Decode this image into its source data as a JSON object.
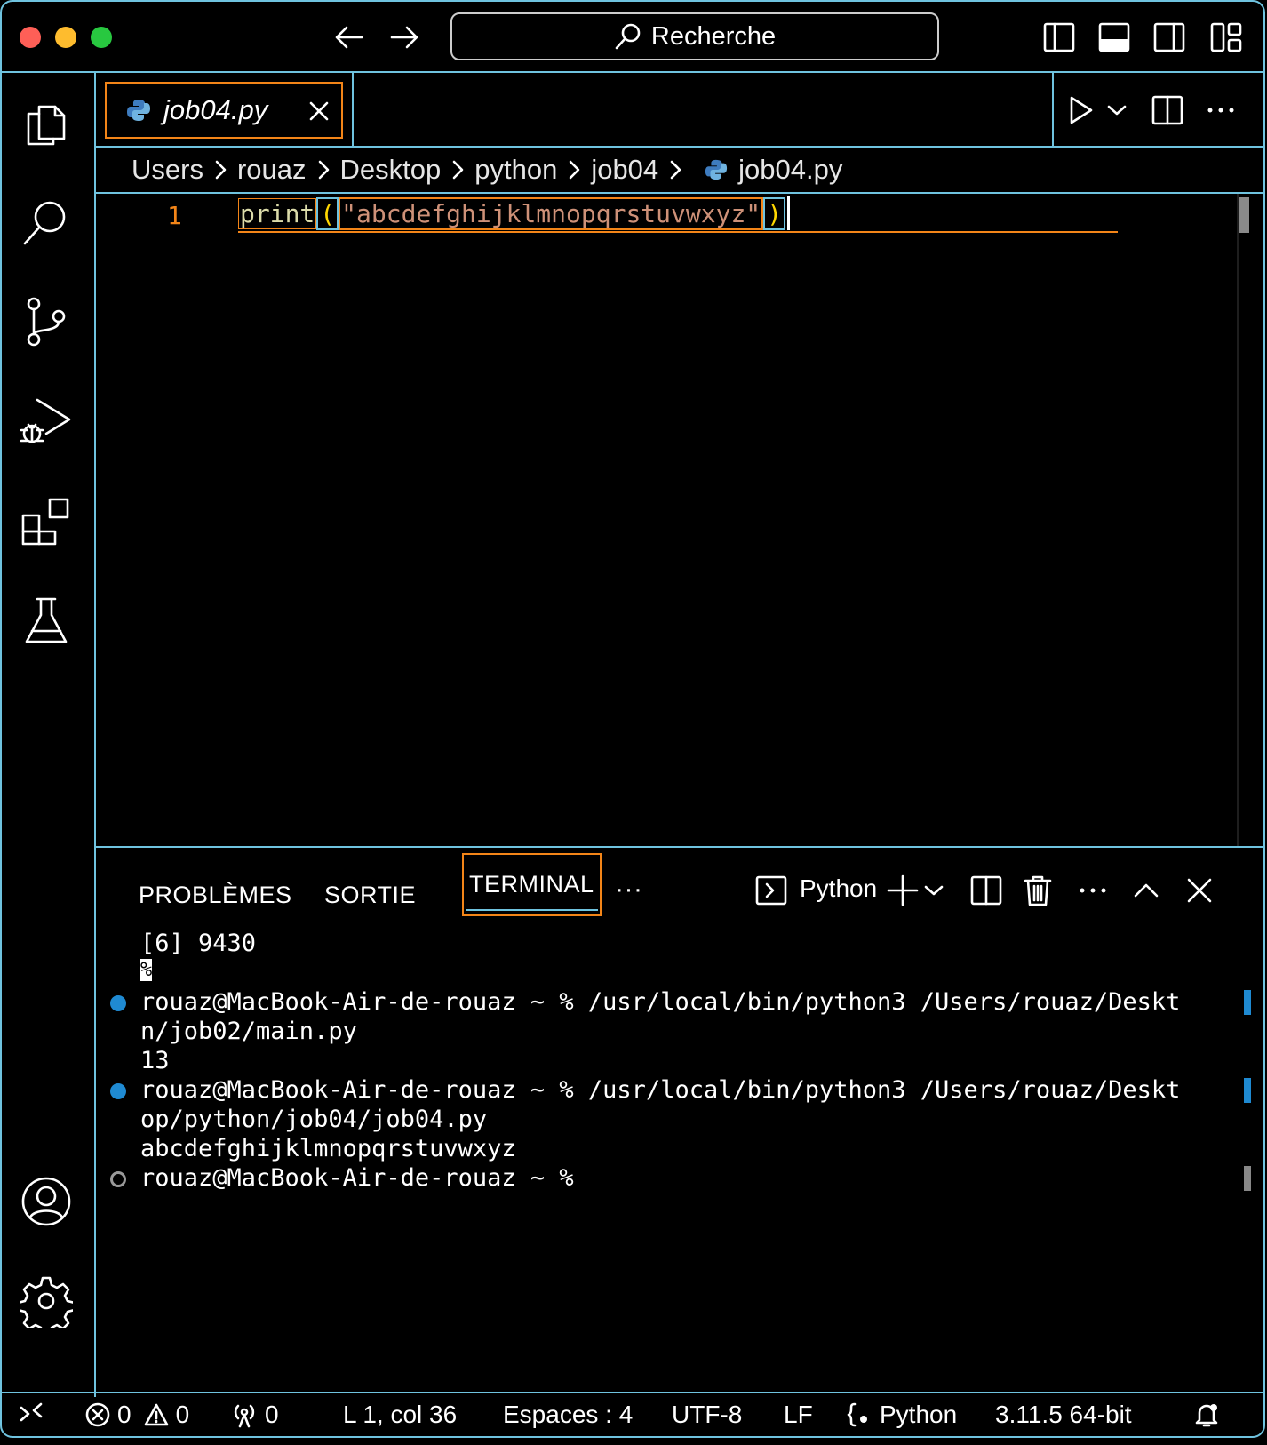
{
  "titlebar": {
    "search_placeholder": "Recherche"
  },
  "tab": {
    "label": "job04.py"
  },
  "breadcrumb": {
    "items": [
      "Users",
      "rouaz",
      "Desktop",
      "python",
      "job04",
      "job04.py"
    ]
  },
  "editor": {
    "line_number": "1",
    "tokens": {
      "fn": "print",
      "open_paren": "(",
      "string": "\"abcdefghijklmnopqrstuvwxyz\"",
      "close_paren": ")"
    }
  },
  "panel": {
    "tabs": [
      "PROBLÈMES",
      "SORTIE",
      "TERMINAL"
    ],
    "more": "···",
    "terminal_profile": "Python",
    "terminal_lines": [
      "[6] 9430",
      "%",
      "rouaz@MacBook-Air-de-rouaz ~ % /usr/local/bin/python3 /Users/rouaz/Deskt",
      "n/job02/main.py",
      "13",
      "rouaz@MacBook-Air-de-rouaz ~ % /usr/local/bin/python3 /Users/rouaz/Deskt",
      "op/python/job04/job04.py",
      "abcdefghijklmnopqrstuvwxyz",
      "rouaz@MacBook-Air-de-rouaz ~ %"
    ]
  },
  "statusbar": {
    "errors": "0",
    "warnings": "0",
    "ports": "0",
    "position": "L 1, col 36",
    "spaces": "Espaces : 4",
    "encoding": "UTF-8",
    "eol": "LF",
    "language": "Python",
    "interpreter": "3.11.5 64-bit"
  },
  "colors": {
    "border_accent": "#6fc3df",
    "focus_orange": "#f38518",
    "terminal_dot_blue": "#1f8ad2"
  }
}
